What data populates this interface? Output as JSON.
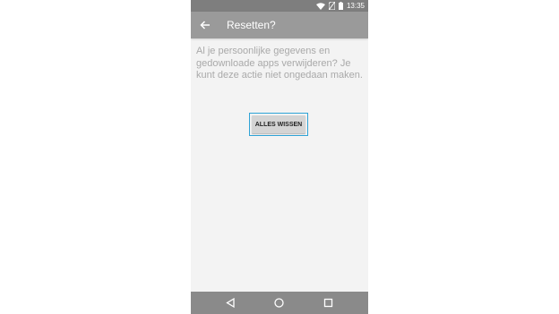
{
  "status_bar": {
    "time": "13:35",
    "icons": [
      "wifi-icon",
      "no-sim-icon",
      "battery-icon"
    ]
  },
  "app_bar": {
    "back_icon": "arrow-left-icon",
    "title": "Resetten?"
  },
  "content": {
    "message": "Al je persoonlijke gegevens en gedownloade apps verwijderen? Je kunt deze actie niet ongedaan maken.",
    "button_label": "ALLES WISSEN"
  },
  "nav_bar": {
    "icons": [
      "back-triangle-icon",
      "home-circle-icon",
      "recents-square-icon"
    ]
  },
  "colors": {
    "status_bar": "#7e7e7e",
    "app_bar": "#9a9a9a",
    "background": "#f3f3f3",
    "text_muted": "#a9a9a9",
    "focus_ring": "#2fa3d6",
    "button_bg": "#d4d4d4",
    "nav_bar": "#8a8a8a"
  }
}
